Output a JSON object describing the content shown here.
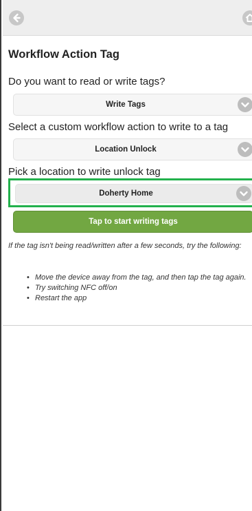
{
  "header": {
    "back_icon": "arrow-left-icon",
    "home_icon": "home-icon"
  },
  "page": {
    "title": "Workflow Action Tag"
  },
  "form": {
    "read_write": {
      "label": "Do you want to read or write tags?",
      "value": "Write Tags"
    },
    "workflow_action": {
      "label": "Select a custom workflow action to write to a tag",
      "value": "Location Unlock"
    },
    "location": {
      "label": "Pick a location to write unlock tag",
      "value": "Doherty Home"
    },
    "start_button_label": "Tap to start writing tags"
  },
  "help": {
    "intro": "If the tag isn't being read/written after a few seconds, try the following:",
    "tips": [
      "Move the device away from the tag, and then tap the tag again.",
      "Try switching NFC off/on",
      "Restart the app"
    ]
  },
  "colors": {
    "accent_green": "#72a742",
    "highlight_green": "#22b14c",
    "header_bg": "#eeeeee"
  }
}
